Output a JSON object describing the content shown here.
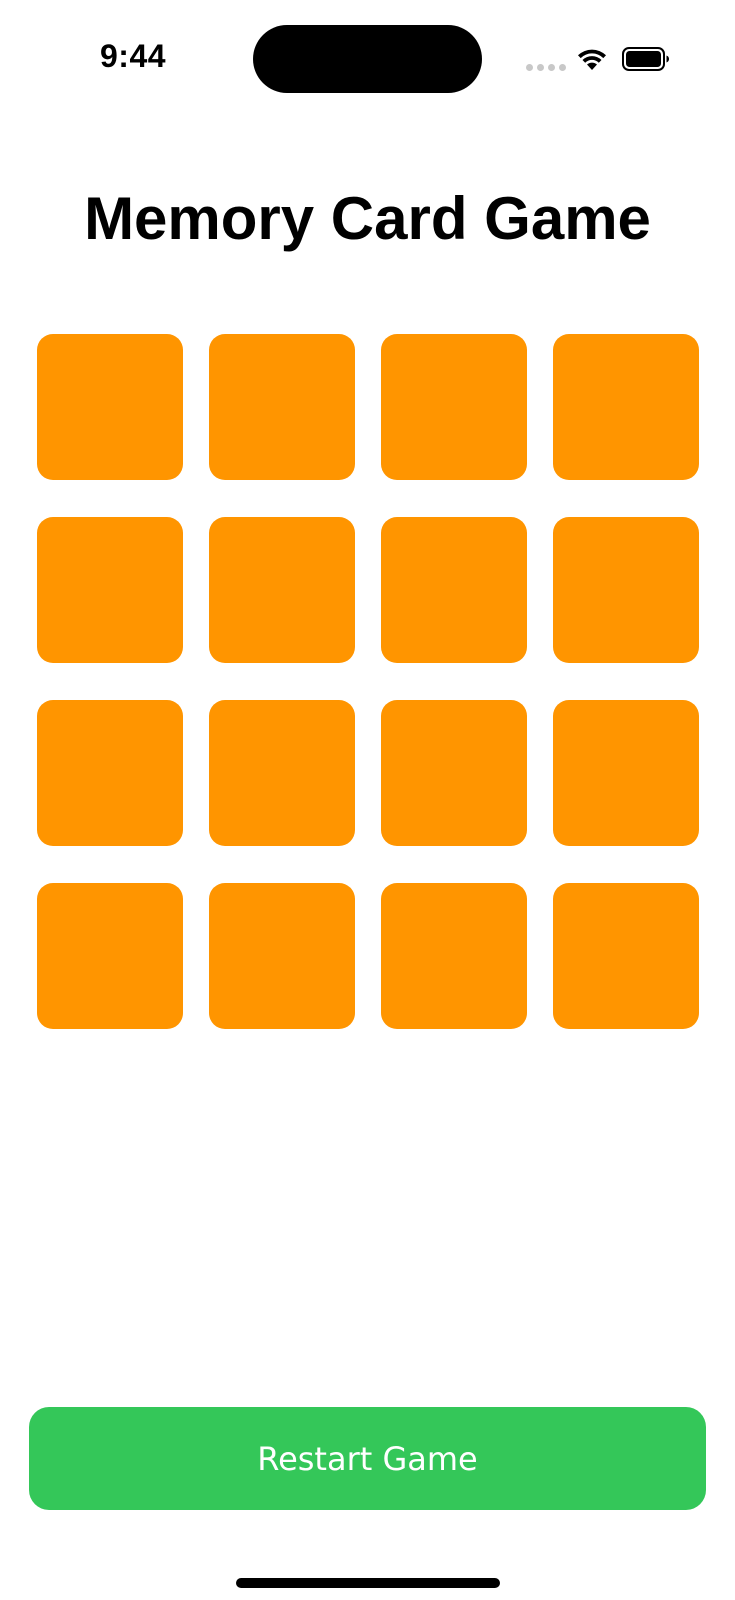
{
  "status_bar": {
    "time": "9:44",
    "icons": [
      "cellular-signal-icon",
      "wifi-icon",
      "battery-icon"
    ]
  },
  "title": "Memory Card Game",
  "cards": {
    "count": 16,
    "columns": 4,
    "rows": 4,
    "state": "face-down",
    "back_color": "#FF9500"
  },
  "restart_button": {
    "label": "Restart Game",
    "color": "#34C759"
  }
}
